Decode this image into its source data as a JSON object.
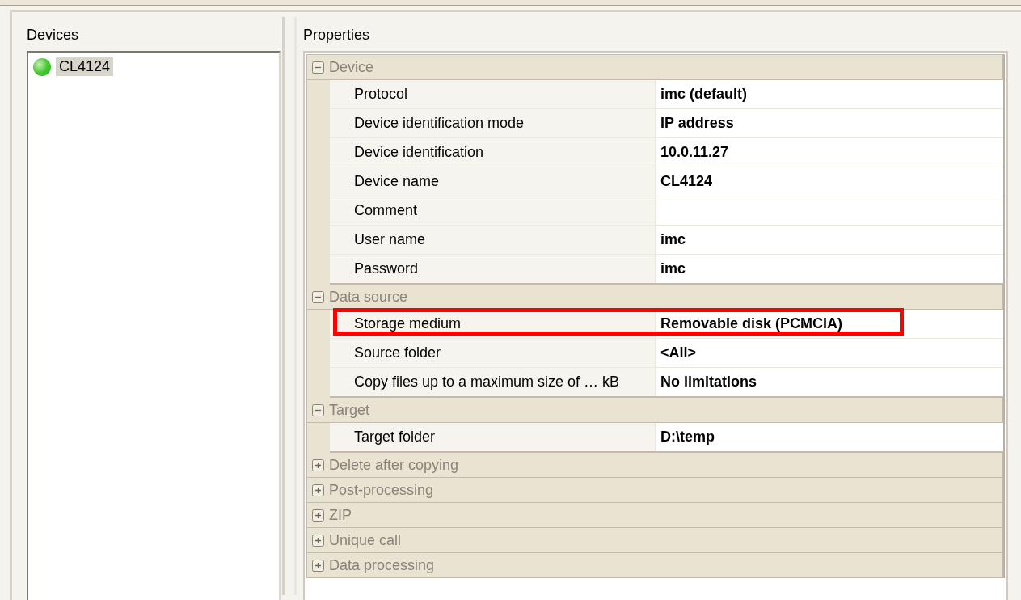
{
  "devices_panel": {
    "label": "Devices",
    "devices": [
      {
        "name": "CL4124",
        "selected": true,
        "color": "#3cc22a"
      }
    ]
  },
  "properties_panel": {
    "label": "Properties",
    "categories": [
      {
        "name": "Device",
        "expanded": true,
        "rows": [
          {
            "label": "Protocol",
            "value": "imc (default)",
            "highlighted": false
          },
          {
            "label": "Device identification mode",
            "value": "IP address",
            "highlighted": false
          },
          {
            "label": "Device identification",
            "value": "10.0.11.27",
            "highlighted": false
          },
          {
            "label": "Device name",
            "value": "CL4124",
            "highlighted": false
          },
          {
            "label": "Comment",
            "highlighted": false
          },
          {
            "label": "User name",
            "value": "imc",
            "highlighted": false
          },
          {
            "label": "Password",
            "value": "imc",
            "highlighted": false
          }
        ]
      },
      {
        "name": "Data source",
        "expanded": true,
        "rows": [
          {
            "label": "Storage medium",
            "value": "Removable disk (PCMCIA)",
            "highlighted": true
          },
          {
            "label": "Source folder",
            "value": "<All>",
            "highlighted": false
          },
          {
            "label": "Copy files up to a maximum size of … kB",
            "value": "No limitations",
            "highlighted": false
          }
        ]
      },
      {
        "name": "Target",
        "expanded": true,
        "rows": [
          {
            "label": "Target folder",
            "value": "D:\\temp",
            "highlighted": false
          }
        ]
      },
      {
        "name": "Delete after copying",
        "expanded": false
      },
      {
        "name": "Post-processing",
        "expanded": false
      },
      {
        "name": "ZIP",
        "expanded": false
      },
      {
        "name": "Unique call",
        "expanded": false
      },
      {
        "name": "Data processing",
        "expanded": false
      }
    ]
  }
}
